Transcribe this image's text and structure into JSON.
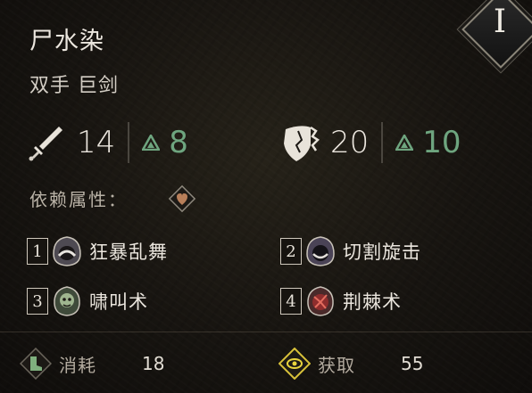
{
  "item": {
    "name": "尸水染",
    "type": "双手 巨剑",
    "tier": "I"
  },
  "stats": {
    "attack": {
      "icon": "sword-icon",
      "value": "14",
      "upgrade": "8"
    },
    "defense": {
      "icon": "shield-icon",
      "value": "20",
      "upgrade": "10"
    }
  },
  "dependency": {
    "label": "依赖属性：",
    "icon": "strength-heart-icon"
  },
  "skills": [
    {
      "slot": "1",
      "name": "狂暴乱舞",
      "icon": "hooded-skull-icon"
    },
    {
      "slot": "2",
      "name": "切割旋击",
      "icon": "hooded-face-icon"
    },
    {
      "slot": "3",
      "name": "啸叫术",
      "icon": "ghoul-icon"
    },
    {
      "slot": "4",
      "name": "荆棘术",
      "icon": "thorn-demon-icon"
    }
  ],
  "footer": {
    "cost": {
      "label": "消耗",
      "value": "18",
      "icon": "boot-icon"
    },
    "gain": {
      "label": "获取",
      "value": "55",
      "icon": "eye-diamond-icon"
    }
  },
  "colors": {
    "upgrade_green": "#6ea57f",
    "text": "#ebe6de",
    "background": "#1a1713"
  }
}
